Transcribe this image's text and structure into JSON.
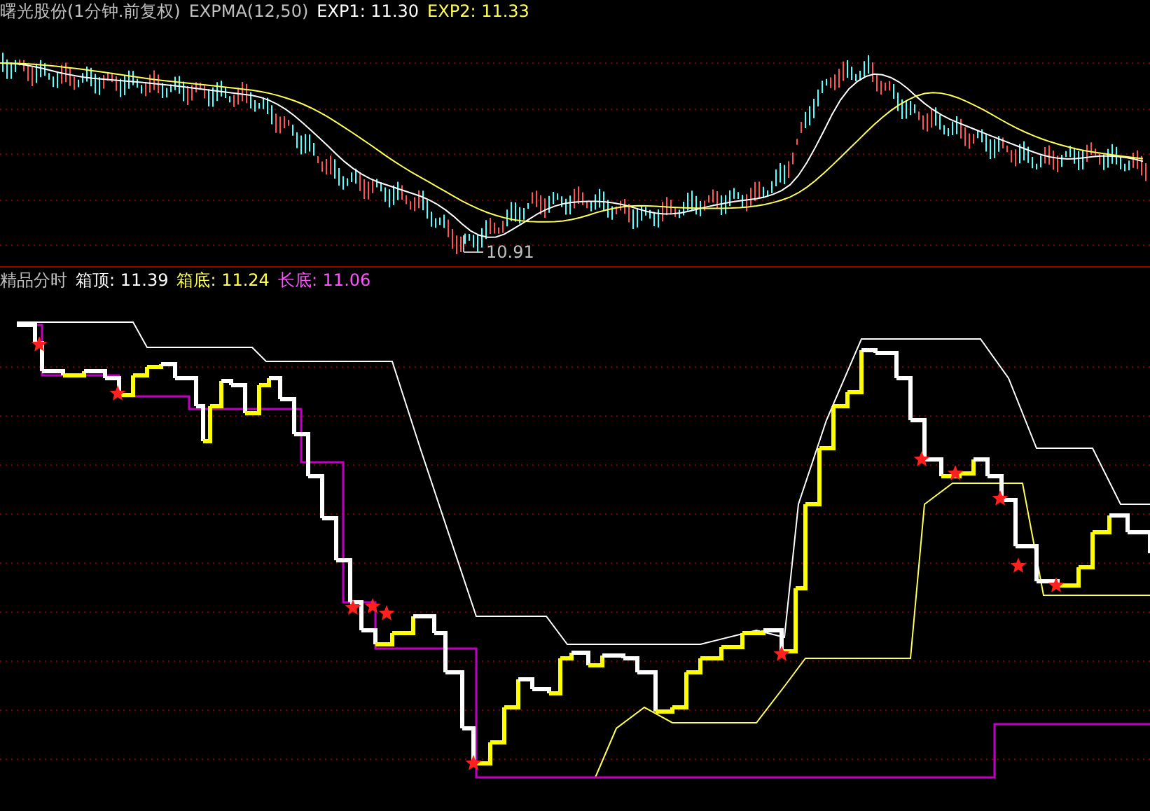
{
  "top_panel": {
    "title": "曙光股份(1分钟.前复权)",
    "indicator": "EXPMA(12,50)",
    "legend": [
      {
        "label": "EXP1: 11.30",
        "color": "#ffffff"
      },
      {
        "label": "EXP2: 11.33",
        "color": "#ffff54"
      }
    ],
    "low_marker": "10.91"
  },
  "bottom_panel": {
    "title": "精品分时",
    "legend": [
      {
        "label": "箱顶: 11.39",
        "color": "#ffffff"
      },
      {
        "label": "箱底: 11.24",
        "color": "#ffff54"
      },
      {
        "label": "长底: 11.06",
        "color": "#ff54ff"
      }
    ]
  }
}
